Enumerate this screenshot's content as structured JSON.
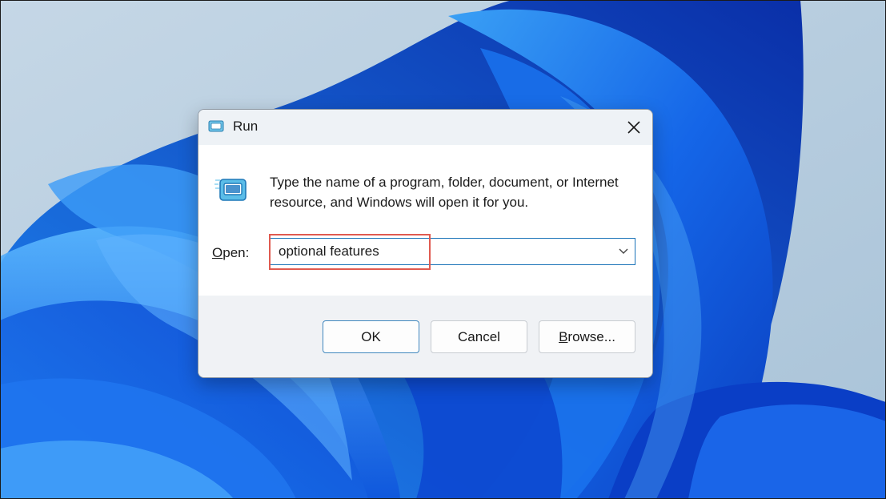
{
  "window": {
    "title": "Run",
    "description": "Type the name of a program, folder, document, or Internet resource, and Windows will open it for you.",
    "open_label_prefix": "O",
    "open_label_rest": "pen:",
    "input_value": "optional features",
    "buttons": {
      "ok": "OK",
      "cancel": "Cancel",
      "browse_prefix": "B",
      "browse_rest": "rowse..."
    }
  },
  "icons": {
    "title": "run-app-icon",
    "large": "run-app-icon",
    "close": "close-icon",
    "dropdown": "chevron-down-icon"
  },
  "colors": {
    "input_border": "#1a73b8",
    "highlight_box": "#e05a50",
    "ok_border": "#3f86bd"
  }
}
